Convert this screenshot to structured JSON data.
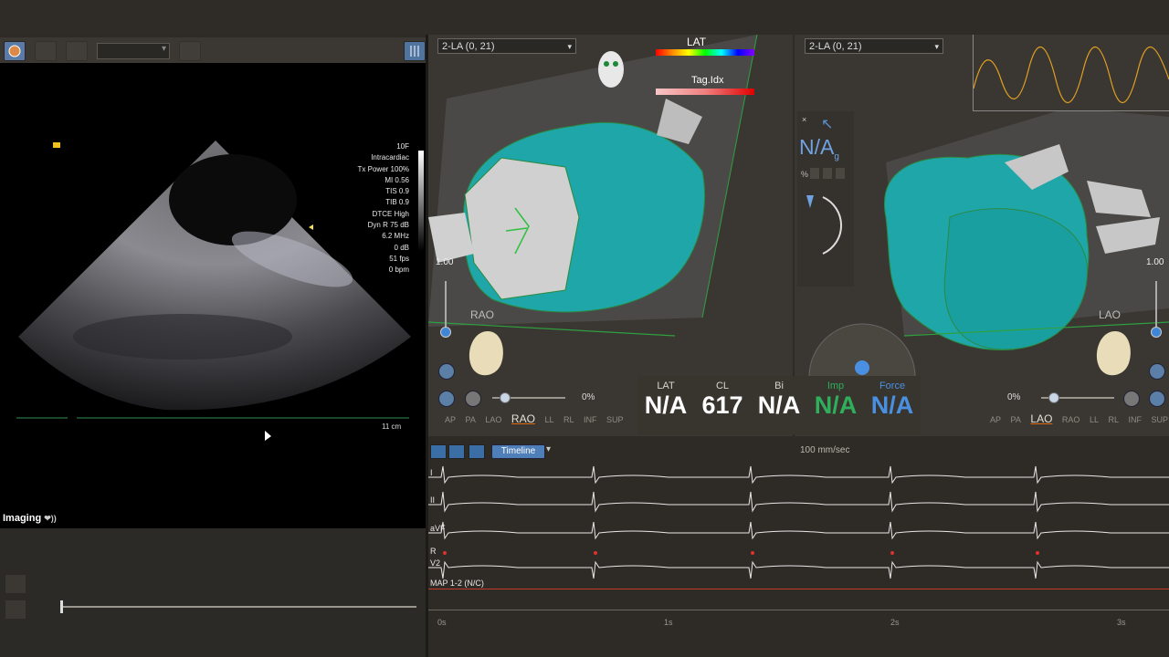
{
  "imaging": {
    "label": "Imaging",
    "params": [
      "10F",
      "Intracardiac",
      "Tx Power 100%",
      "MI 0.56",
      "TIS 0.9",
      "TIB 0.9",
      "DTCE High",
      "Dyn R 75 dB",
      "6.2 MHz",
      "0 dB",
      "51 fps",
      "0 bpm"
    ],
    "depth": "11 cm"
  },
  "view_left": {
    "select": "2-LA (0, 21)",
    "legend_lat": "LAT",
    "legend_tag": "Tag.Idx",
    "scale": "1.00",
    "orientation": "RAO",
    "zoom": "0%",
    "orient_buttons": [
      "AP",
      "PA",
      "LAO",
      "RAO",
      "LL",
      "RL",
      "INF",
      "SUP"
    ],
    "active_orient": "RAO"
  },
  "view_right": {
    "select": "2-LA (0, 21)",
    "scale": "1.00",
    "orientation": "LAO",
    "zoom": "0%",
    "orient_buttons": [
      "AP",
      "PA",
      "LAO",
      "RAO",
      "LL",
      "RL",
      "INF",
      "SUP"
    ],
    "active_orient": "LAO"
  },
  "mid_panel": {
    "value": "N/A",
    "subscript": "g",
    "pct": "%"
  },
  "stats": [
    {
      "label": "LAT",
      "value": "N/A",
      "label_color": "#d8d4cc",
      "value_color": "#ffffff"
    },
    {
      "label": "CL",
      "value": "617",
      "label_color": "#d8d4cc",
      "value_color": "#ffffff"
    },
    {
      "label": "Bi",
      "value": "N/A",
      "label_color": "#d8d4cc",
      "value_color": "#ffffff"
    },
    {
      "label": "Imp",
      "value": "N/A",
      "label_color": "#2fae5c",
      "value_color": "#2fae5c"
    },
    {
      "label": "Force",
      "value": "N/A",
      "label_color": "#4a90e2",
      "value_color": "#4a90e2"
    }
  ],
  "ecg": {
    "timeline_label": "Timeline",
    "speed": "100 mm/sec",
    "leads": [
      "I",
      "II",
      "aVF",
      "R",
      "V2",
      "MAP 1-2 (N/C)"
    ],
    "time_ticks": [
      "0s",
      "1s",
      "2s",
      "3s"
    ]
  },
  "colors": {
    "accent": "#e06a10",
    "mesh": "#1fa6a8",
    "ecg_trace": "#e8e8e8",
    "map_line": "#c0392b"
  }
}
